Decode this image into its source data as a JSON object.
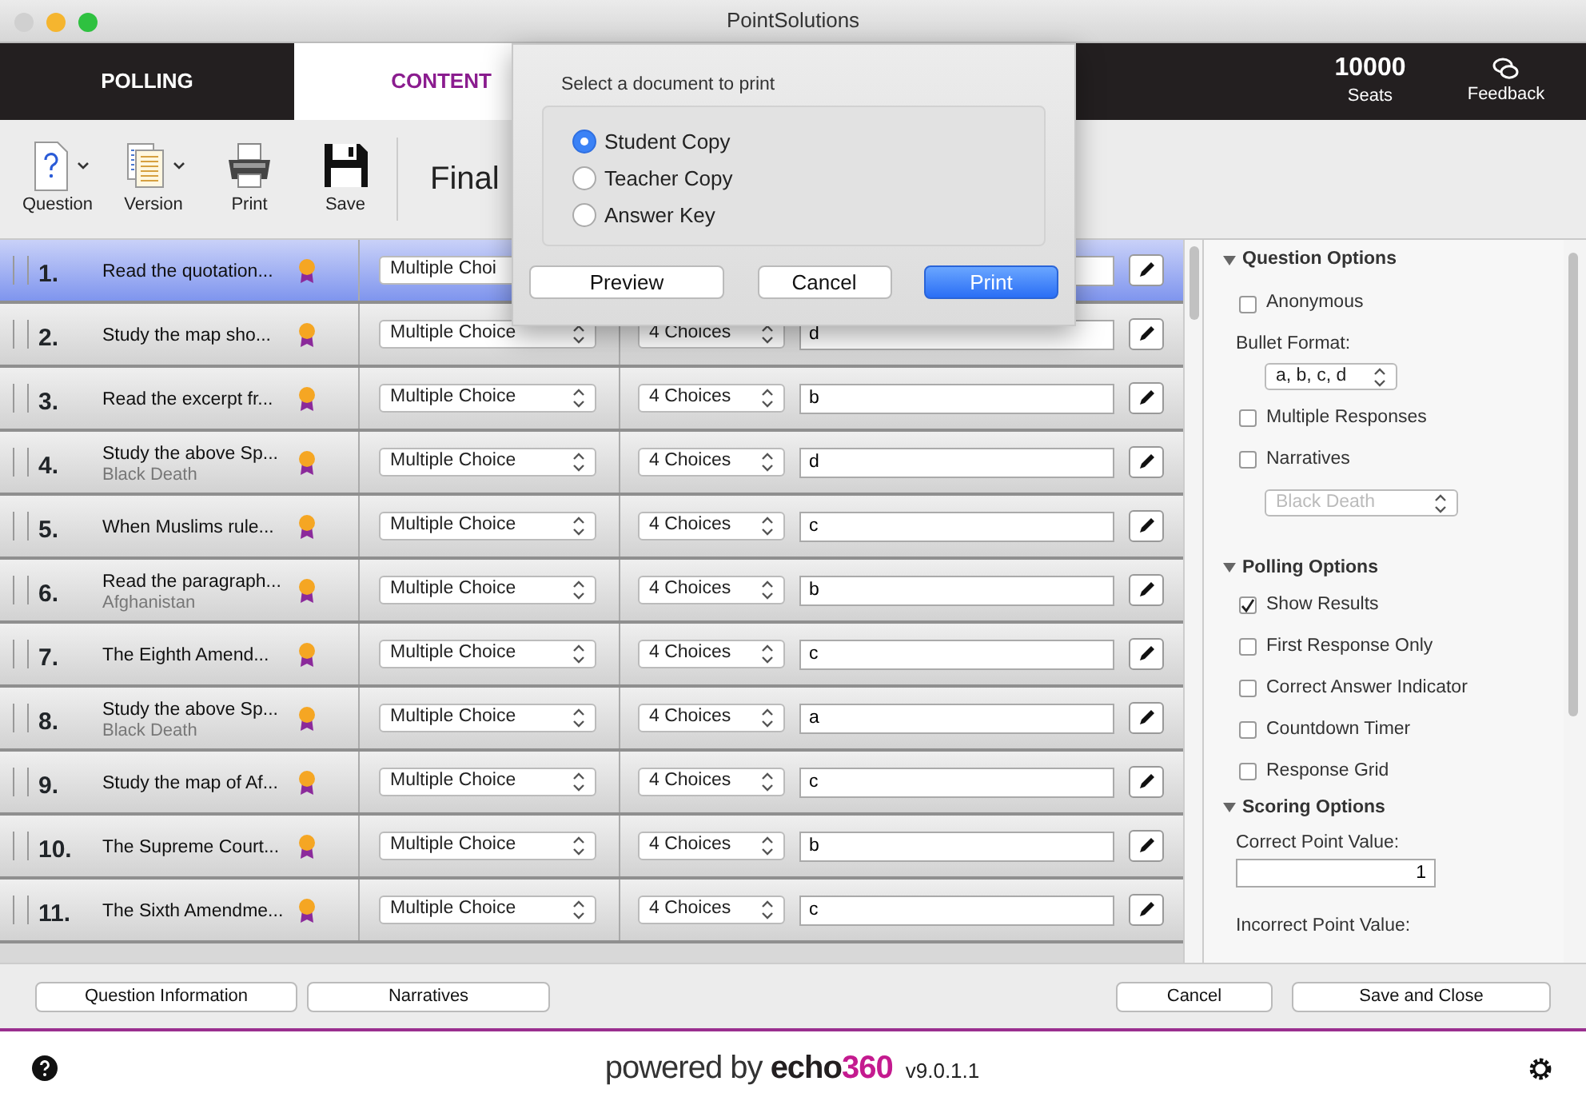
{
  "window": {
    "title": "PointSolutions"
  },
  "nav": {
    "tabs": [
      {
        "label": "POLLING",
        "selected": false
      },
      {
        "label": "CONTENT",
        "selected": true
      }
    ],
    "seats": {
      "value": "10000",
      "label": "Seats"
    },
    "feedback": "Feedback"
  },
  "toolbar": {
    "buttons": [
      {
        "label": "Question",
        "kind": "question",
        "menu": true
      },
      {
        "label": "Version",
        "kind": "version",
        "menu": true
      },
      {
        "label": "Print",
        "kind": "print",
        "menu": false
      },
      {
        "label": "Save",
        "kind": "save",
        "menu": false
      }
    ],
    "title": "Final"
  },
  "questions": [
    {
      "number": "1.",
      "text": "Read the quotation...",
      "type": "Multiple Choi",
      "selected": true
    },
    {
      "number": "2.",
      "text": "Study the map sho...",
      "type": "Multiple Choice",
      "choices": "4 Choices",
      "answer": "d",
      "selected": false
    },
    {
      "number": "3.",
      "text": "Read the excerpt fr...",
      "type": "Multiple Choice",
      "choices": "4 Choices",
      "answer": "b",
      "selected": false
    },
    {
      "number": "4.",
      "text": "Study the above Sp...",
      "subtitle": "Black Death",
      "type": "Multiple Choice",
      "choices": "4 Choices",
      "answer": "d",
      "selected": false
    },
    {
      "number": "5.",
      "text": "When Muslims rule...",
      "type": "Multiple Choice",
      "choices": "4 Choices",
      "answer": "c",
      "selected": false
    },
    {
      "number": "6.",
      "text": "Read the paragraph...",
      "subtitle": "Afghanistan",
      "type": "Multiple Choice",
      "choices": "4 Choices",
      "answer": "b",
      "selected": false
    },
    {
      "number": "7.",
      "text": "The Eighth Amend...",
      "type": "Multiple Choice",
      "choices": "4 Choices",
      "answer": "c",
      "selected": false
    },
    {
      "number": "8.",
      "text": "Study the above Sp...",
      "subtitle": "Black Death",
      "type": "Multiple Choice",
      "choices": "4 Choices",
      "answer": "a",
      "selected": false
    },
    {
      "number": "9.",
      "text": "Study the map of Af...",
      "type": "Multiple Choice",
      "choices": "4 Choices",
      "answer": "c",
      "selected": false
    },
    {
      "number": "10.",
      "text": "The Supreme Court...",
      "type": "Multiple Choice",
      "choices": "4 Choices",
      "answer": "b",
      "selected": false
    },
    {
      "number": "11.",
      "text": "The Sixth Amendme...",
      "type": "Multiple Choice",
      "choices": "4 Choices",
      "answer": "c",
      "selected": false
    }
  ],
  "options": [
    {
      "title": "Question Options",
      "expanded": true,
      "items": [
        {
          "kind": "checkbox",
          "label": "Anonymous",
          "checked": false
        },
        {
          "kind": "select",
          "label": "Bullet Format:",
          "value": "a, b, c, d",
          "disabled": false
        },
        {
          "kind": "checkbox",
          "label": "Multiple Responses",
          "checked": false
        },
        {
          "kind": "checkbox",
          "label": "Narratives",
          "checked": false
        },
        {
          "kind": "select",
          "value": "Black Death",
          "disabled": true
        }
      ]
    },
    {
      "title": "Polling Options",
      "expanded": true,
      "items": [
        {
          "kind": "checkbox",
          "label": "Show Results",
          "checked": true
        },
        {
          "kind": "checkbox",
          "label": "First Response Only",
          "checked": false
        },
        {
          "kind": "checkbox",
          "label": "Correct Answer Indicator",
          "checked": false
        },
        {
          "kind": "checkbox",
          "label": "Countdown Timer",
          "checked": false
        },
        {
          "kind": "checkbox",
          "label": "Response Grid",
          "checked": false
        }
      ]
    },
    {
      "title": "Scoring Options",
      "expanded": true,
      "items": [
        {
          "kind": "number",
          "label": "Correct Point Value:",
          "value": "1"
        },
        {
          "kind": "label",
          "label": "Incorrect Point Value:"
        }
      ]
    }
  ],
  "bottom_buttons": {
    "left": [
      "Question Information",
      "Narratives"
    ],
    "right": [
      "Cancel",
      "Save and Close"
    ]
  },
  "footer": {
    "powered": "powered by",
    "brand": "echo",
    "brand_number": "360",
    "version": "v9.0.1.1"
  },
  "dialog": {
    "prompt": "Select a document to print",
    "options": [
      {
        "label": "Student Copy",
        "selected": true
      },
      {
        "label": "Teacher Copy",
        "selected": false
      },
      {
        "label": "Answer Key",
        "selected": false
      }
    ],
    "buttons": [
      {
        "label": "Preview",
        "kind": "default"
      },
      {
        "label": "Cancel",
        "kind": "default"
      },
      {
        "label": "Print",
        "kind": "primary"
      }
    ]
  }
}
